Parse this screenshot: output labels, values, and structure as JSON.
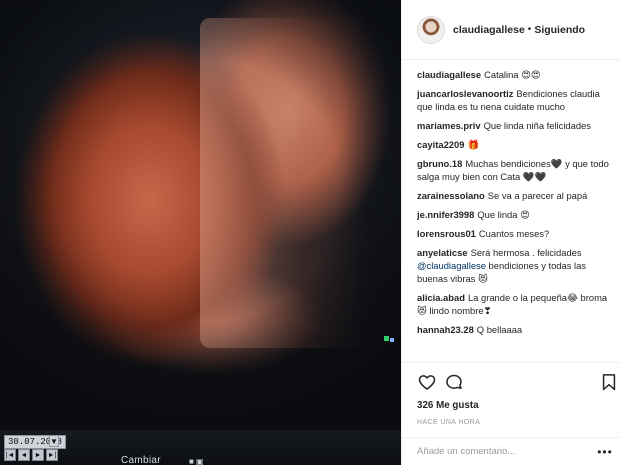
{
  "photo": {
    "date": "30.07.2018",
    "date_arrow": "▼",
    "nav_glyphs": [
      "|◄",
      "◄",
      "►",
      "►|"
    ],
    "bottom_label": "Cambiar",
    "bottom_icons": "■ ▣"
  },
  "header": {
    "username": "claudiagallese",
    "separator": "•",
    "follow_state": "Siguiendo"
  },
  "comments": [
    {
      "user": "claudiagallese",
      "text": "Catalina 😍😍"
    },
    {
      "user": "juancarloslevanoortiz",
      "text": "Bendiciones claudia que linda es tu nena cuidate mucho"
    },
    {
      "user": "mariames.priv",
      "text": "Que linda niña felicidades"
    },
    {
      "user": "cayita2209",
      "text": "🎁"
    },
    {
      "user": "gbruno.18",
      "text": "Muchas bendiciones🖤 y que todo salga muy bien con Cata 🖤🖤"
    },
    {
      "user": "zarainessolano",
      "text": "Se va a parecer al papá"
    },
    {
      "user": "je.nnifer3998",
      "text": "Que linda 😍"
    },
    {
      "user": "lorensrous01",
      "text": "Cuantos meses?"
    },
    {
      "user": "anyelaticse",
      "text": "Será hermosa . felicidades",
      "mention": "@claudiagallese",
      "text2": "bendiciones y todas las buenas vibras 😻"
    },
    {
      "user": "alicia.abad",
      "text": "La grande o la pequeña😂 broma 😻 lindo nombre❣"
    },
    {
      "user": "hannah23.28",
      "text": "Q bellaaaa"
    }
  ],
  "actions": {
    "like_icon": "heart-outline",
    "comment_icon": "speech-bubble",
    "save_icon": "bookmark"
  },
  "likes": "326 Me gusta",
  "timestamp": "Hace una hora",
  "add_comment": {
    "placeholder": "Añade un comentario...",
    "more": "•••"
  }
}
